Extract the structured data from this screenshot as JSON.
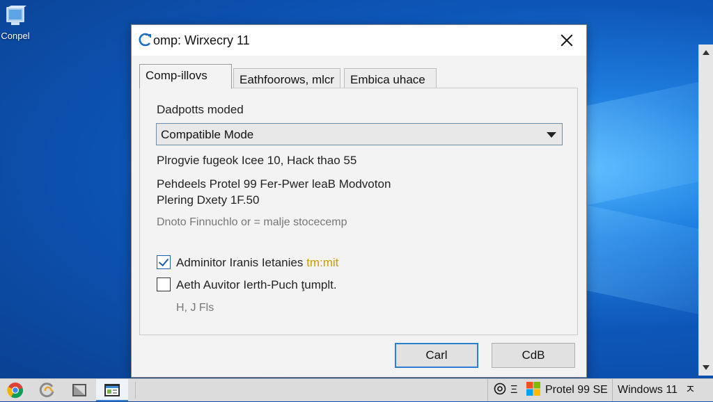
{
  "desktop": {
    "icon_label": "Conpel"
  },
  "dialog": {
    "title": "omp: Wirxecry 11",
    "tabs": [
      {
        "label": "Comp-illovs"
      },
      {
        "label": "Eathfoorows, mlcr"
      },
      {
        "label": "Embica uhace"
      }
    ],
    "field_label": "Dadpotts moded",
    "select_value": "Compatible Mode",
    "info_lines": [
      "Plrogvie fugeok Icee 10, Hack thao 55",
      "Pehdeels Protel 99 Fer-Pwer leaB Modvoton",
      "Plering Dxety 1F.50"
    ],
    "muted_line": "Dnoto Finnuchlo or = malje stocecemp",
    "checkboxes": [
      {
        "label": "Adminitor Iranis Ietanies",
        "accent": "tm:mit",
        "checked": true
      },
      {
        "label": "Aeth Auvitor Ierth-Puch ţumplt.",
        "checked": false
      }
    ],
    "small_text": "H, J Fls",
    "buttons": {
      "primary": "Carl",
      "secondary": "CdB"
    }
  },
  "taskbar": {
    "tray_symbol": "Ξ",
    "tray_app": "Protel 99 SE",
    "tray_os": "Windows 11",
    "tray_chevron": "ㅈ"
  },
  "colors": {
    "desktop_blue": "#0d56b8",
    "accent_blue": "#2c7fd0",
    "checkbox_accent_text": "#c89a00"
  }
}
